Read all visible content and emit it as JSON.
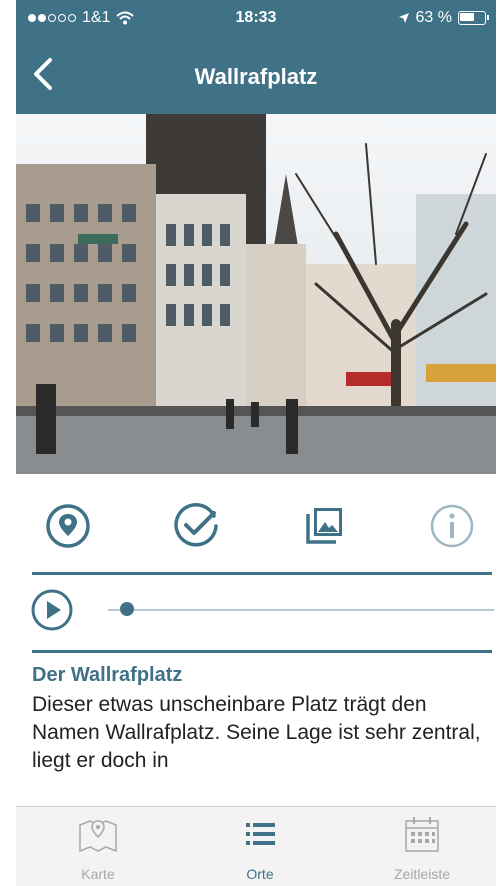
{
  "status": {
    "carrier": "1&1",
    "time": "18:33",
    "battery": "63 %",
    "battery_level": 0.63
  },
  "nav": {
    "title": "Wallrafplatz"
  },
  "article": {
    "heading": "Der Wallrafplatz",
    "body": "Dieser etwas unscheinbare Platz trägt den Namen Wallrafplatz. Seine Lage ist sehr zentral, liegt er doch in"
  },
  "player": {
    "progress": 0.03
  },
  "tabs": [
    {
      "label": "Karte",
      "icon": "map-icon"
    },
    {
      "label": "Orte",
      "icon": "list-icon",
      "active": true
    },
    {
      "label": "Zeitleiste",
      "icon": "calendar-icon"
    }
  ],
  "colors": {
    "accent": "#3f7287",
    "inactive": "#a8a8a8"
  }
}
